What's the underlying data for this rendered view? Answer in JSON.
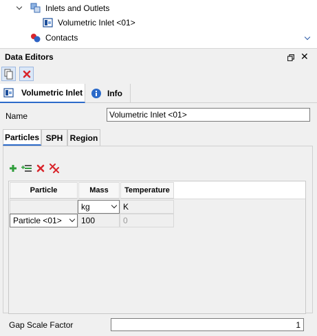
{
  "tree": {
    "items": [
      {
        "label": "Inlets and Outlets",
        "icon": "inlets-outlets-icon"
      },
      {
        "label": "Volumetric Inlet <01>",
        "icon": "volumetric-inlet-icon"
      },
      {
        "label": "Contacts",
        "icon": "contacts-icon"
      }
    ]
  },
  "panel": {
    "title": "Data Editors",
    "tabs": [
      {
        "label": "Volumetric Inlet",
        "icon": "volumetric-inlet-icon"
      },
      {
        "label": "Info",
        "icon": "info-icon"
      }
    ],
    "name_label": "Name",
    "name_value": "Volumetric Inlet <01>",
    "sub_tabs": [
      "Particles",
      "SPH",
      "Region"
    ],
    "grid": {
      "columns": [
        "Particle",
        "Mass",
        "Temperature"
      ],
      "units": {
        "mass": "kg",
        "temperature": "K"
      },
      "rows": [
        {
          "particle": "Particle <01>",
          "mass": "100",
          "temperature": "0"
        }
      ]
    },
    "gap_label": "Gap Scale Factor",
    "gap_value": "1"
  },
  "colors": {
    "accent": "#2b6ac9",
    "delete_red": "#d9262c",
    "add_green": "#2e9d3a"
  }
}
